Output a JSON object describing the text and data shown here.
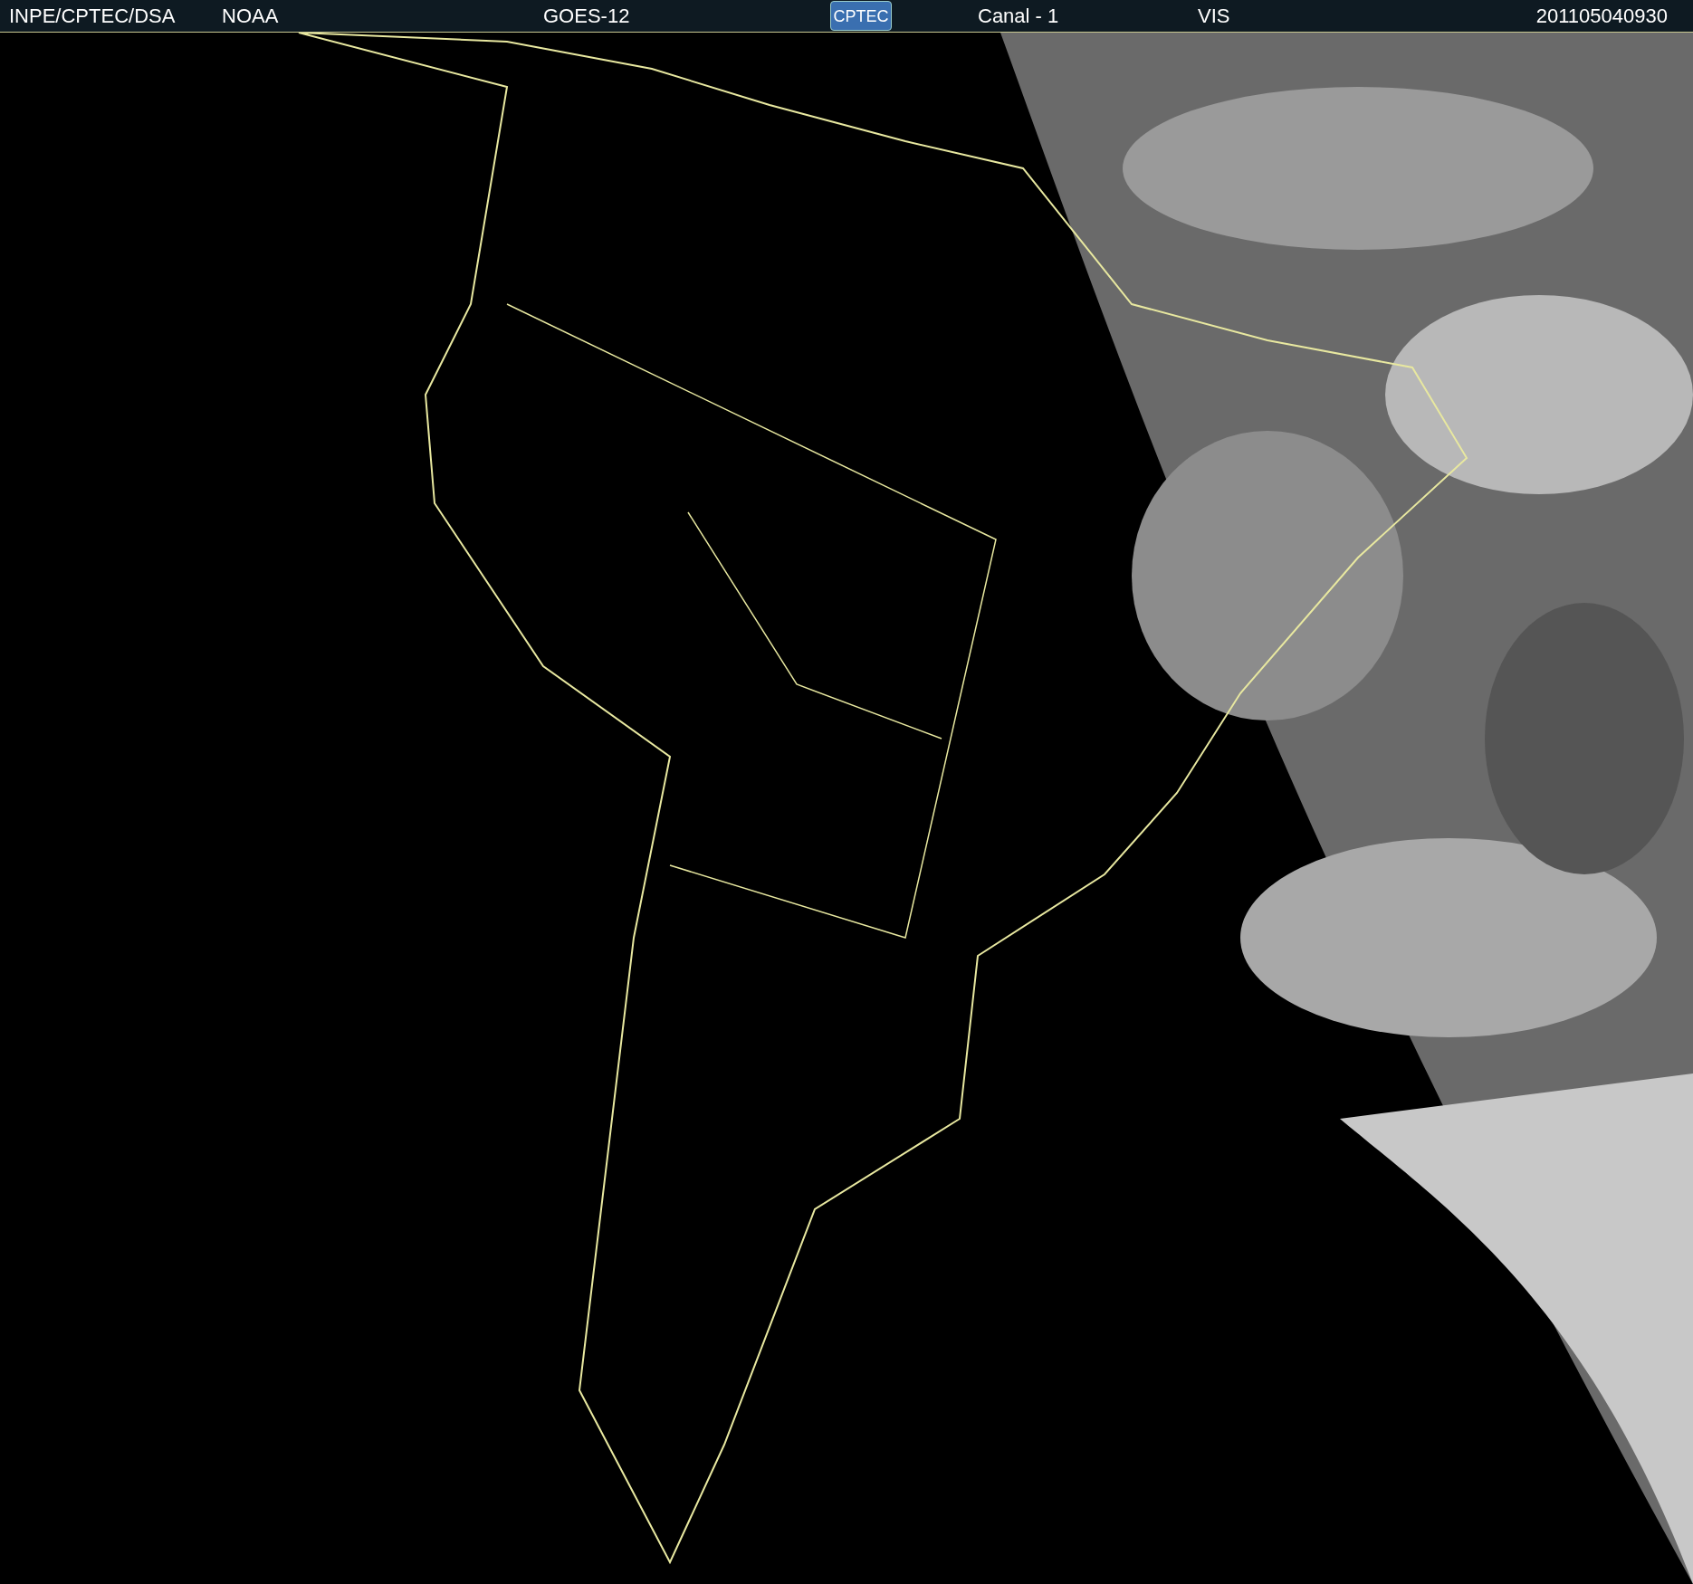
{
  "header": {
    "source": "INPE/CPTEC/DSA",
    "agency": "NOAA",
    "satellite": "GOES-12",
    "logo": "CPTEC",
    "channel": "Canal - 1",
    "band": "VIS",
    "timestamp": "201105040930"
  }
}
